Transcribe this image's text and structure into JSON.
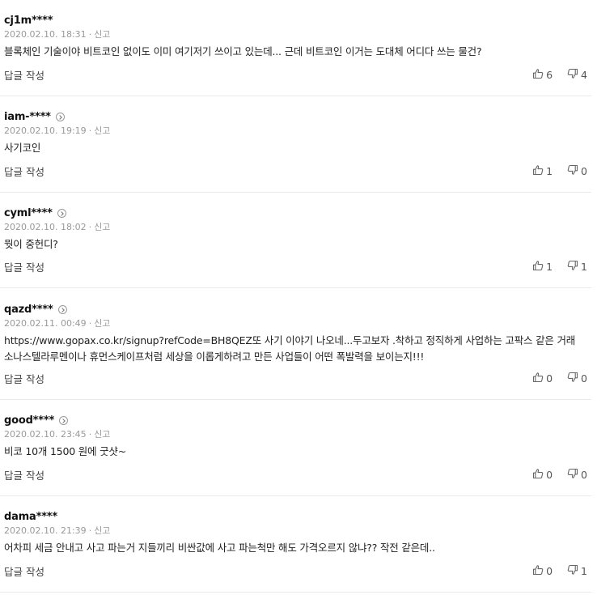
{
  "reply_label": "답글 작성",
  "report_label": "신고",
  "comments": [
    {
      "author": "cj1m****",
      "date": "2020.02.10. 18:31",
      "text": "블록체인 기술이야 비트코인 없이도 이미 여기저기 쓰이고 있는데... 근데 비트코인 이거는 도대체 어디다 쓰는 물건?",
      "likes": "6",
      "dislikes": "4",
      "profile_arrow": false
    },
    {
      "author": "iam-****",
      "date": "2020.02.10. 19:19",
      "text": "사기코인",
      "likes": "1",
      "dislikes": "0",
      "profile_arrow": true
    },
    {
      "author": "cyml****",
      "date": "2020.02.10. 18:02",
      "text": "뭣이 중헌디?",
      "likes": "1",
      "dislikes": "1",
      "profile_arrow": true
    },
    {
      "author": "qazd****",
      "date": "2020.02.11. 00:49",
      "text": "https://www.gopax.co.kr/signup?refCode=BH8QEZ또 사기 이야기 나오네...두고보자 .착하고 정직하게 사업하는 고팍스 같은 거래\n소나스텔라루멘이나 휴먼스케이프처럼 세상을 이롭게하려고 만든 사업들이 어떤 폭발력을 보이는지!!!",
      "likes": "0",
      "dislikes": "0",
      "profile_arrow": true
    },
    {
      "author": "good****",
      "date": "2020.02.10. 23:45",
      "text": "비코 10개 1500 원에 굿샷~",
      "likes": "0",
      "dislikes": "0",
      "profile_arrow": true
    },
    {
      "author": "dama****",
      "date": "2020.02.10. 21:39",
      "text": "어차피 세금 안내고 사고 파는거 지들끼리 비싼값에 사고 파는척만 해도 가격오르지 않냐?? 작전 같은데..",
      "likes": "0",
      "dislikes": "1",
      "profile_arrow": false
    }
  ]
}
